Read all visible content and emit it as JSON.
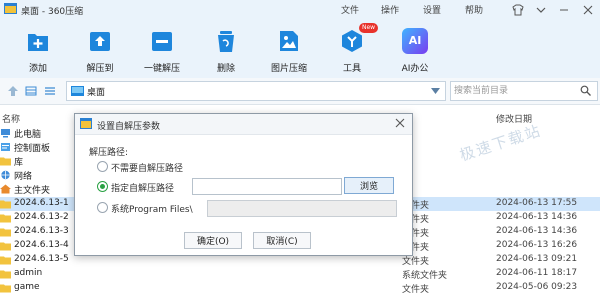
{
  "app": {
    "title": "桌面 - 360压缩"
  },
  "menu": {
    "file": "文件",
    "operate": "操作",
    "settings": "设置",
    "help": "帮助"
  },
  "toolbar": {
    "add": "添加",
    "extract_to": "解压到",
    "one_click": "一键解压",
    "delete": "删除",
    "image_compress": "图片压缩",
    "tools": "工具",
    "tools_badge": "New",
    "ai_office": "AI办公",
    "ai_icon_text": "AI"
  },
  "address": {
    "path": "桌面"
  },
  "search": {
    "placeholder": "搜索当前目录"
  },
  "columns": {
    "name": "名称",
    "modified": "修改日期"
  },
  "files": [
    {
      "name": "此电脑",
      "type": "",
      "date": "",
      "icon": "pc-icon"
    },
    {
      "name": "控制面板",
      "type": "",
      "date": "",
      "icon": "control-panel-icon"
    },
    {
      "name": "库",
      "type": "",
      "date": "",
      "icon": "folder-icon"
    },
    {
      "name": "网络",
      "type": "",
      "date": "",
      "icon": "network-icon"
    },
    {
      "name": "主文件夹",
      "type": "",
      "date": "",
      "icon": "home-icon"
    },
    {
      "name": "2024.6.13-1",
      "type": "文件夹",
      "date": "2024-06-13 17:55",
      "icon": "folder-icon"
    },
    {
      "name": "2024.6.13-2",
      "type": "文件夹",
      "date": "2024-06-13 14:36",
      "icon": "folder-icon"
    },
    {
      "name": "2024.6.13-3",
      "type": "文件夹",
      "date": "2024-06-13 14:36",
      "icon": "folder-icon"
    },
    {
      "name": "2024.6.13-4",
      "type": "文件夹",
      "date": "2024-06-13 16:26",
      "icon": "folder-icon"
    },
    {
      "name": "2024.6.13-5",
      "type": "文件夹",
      "date": "2024-06-13 09:21",
      "icon": "folder-icon"
    },
    {
      "name": "admin",
      "type": "系统文件夹",
      "date": "2024-06-11 18:17",
      "icon": "folder-icon"
    },
    {
      "name": "game",
      "type": "文件夹",
      "date": "2024-05-06 09:23",
      "icon": "folder-icon"
    }
  ],
  "watermark": "极速下载站",
  "dialog": {
    "title": "设置自解压参数",
    "path_label": "解压路径:",
    "opt_none": "不需要自解压路径",
    "opt_custom": "指定自解压路径",
    "opt_program_files": "系统Program Files\\",
    "path_value": "",
    "browse": "浏览",
    "ok": "确定(O)",
    "cancel": "取消(C)"
  }
}
